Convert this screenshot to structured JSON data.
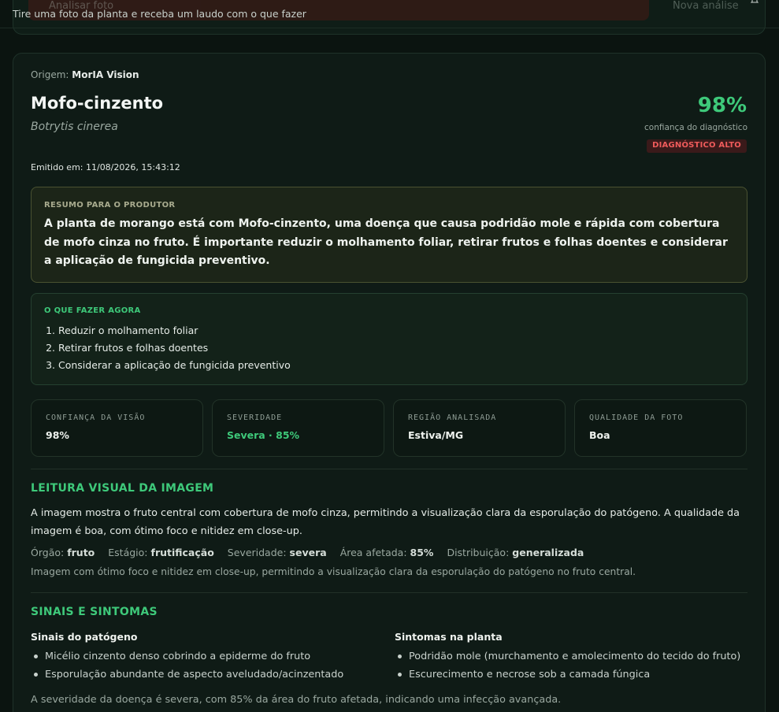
{
  "header": {
    "analyze_label": "Analisar foto",
    "new_analysis_label": "Nova análise",
    "tagline": "Tire uma foto da planta e receba um laudo com o que fazer"
  },
  "report": {
    "origin_prefix": "Origem:",
    "origin_value": "MorIA Vision",
    "title": "Mofo-cinzento",
    "scientific_name": "Botrytis cinerea",
    "confidence_pct": "98%",
    "confidence_label": "confiança do diagnóstico",
    "confidence_badge": "DIAGNÓSTICO ALTO",
    "emitted": "Emitido em: 11/08/2026, 15:43:12",
    "summary_label": "RESUMO PARA O PRODUTOR",
    "summary_text": "A planta de morango está com Mofo-cinzento, uma doença que causa podridão mole e rápida com cobertura de mofo cinza no fruto. É importante reduzir o molhamento foliar, retirar frutos e folhas doentes e considerar a aplicação de fungicida preventivo.",
    "todo_label": "O QUE FAZER AGORA",
    "todo_items": [
      "Reduzir o molhamento foliar",
      "Retirar frutos e folhas doentes",
      "Considerar a aplicação de fungicida preventivo"
    ],
    "metrics": [
      {
        "label": "CONFIANÇA DA VISÃO",
        "value": "98%"
      },
      {
        "label": "SEVERIDADE",
        "value": "Severa · 85%"
      },
      {
        "label": "REGIÃO ANALISADA",
        "value": "Estiva/MG"
      },
      {
        "label": "QUALIDADE DA FOTO",
        "value": "Boa"
      }
    ],
    "visual_title": "LEITURA VISUAL DA IMAGEM",
    "visual_text": "A imagem mostra o fruto central com cobertura de mofo cinza, permitindo a visualização clara da esporulação do patógeno. A qualidade da imagem é boa, com ótimo foco e nitidez em close-up.",
    "meta": {
      "organ_label": "Órgão:",
      "organ": "fruto",
      "stage_label": "Estágio:",
      "stage": "frutificação",
      "severity_label": "Severidade:",
      "severity": "severa",
      "area_label": "Área afetada:",
      "area": "85%",
      "distribution_label": "Distribuição:",
      "distribution": "generalizada"
    },
    "visual_note": "Imagem com ótimo foco e nitidez em close-up, permitindo a visualização clara da esporulação do patógeno no fruto central.",
    "signs_title": "SINAIS E SINTOMAS",
    "pathogen_title": "Sinais do patógeno",
    "pathogen_items": [
      "Micélio cinzento denso cobrindo a epiderme do fruto",
      "Esporulação abundante de aspecto aveludado/acinzentado"
    ],
    "symptoms_title": "Sintomas na planta",
    "symptoms_items": [
      "Podridão mole (murchamento e amolecimento do tecido do fruto)",
      "Escurecimento e necrose sob a camada fúngica"
    ],
    "severity_text": "A severidade da doença é severa, com 85% da área do fruto afetada, indicando uma infecção avançada."
  }
}
